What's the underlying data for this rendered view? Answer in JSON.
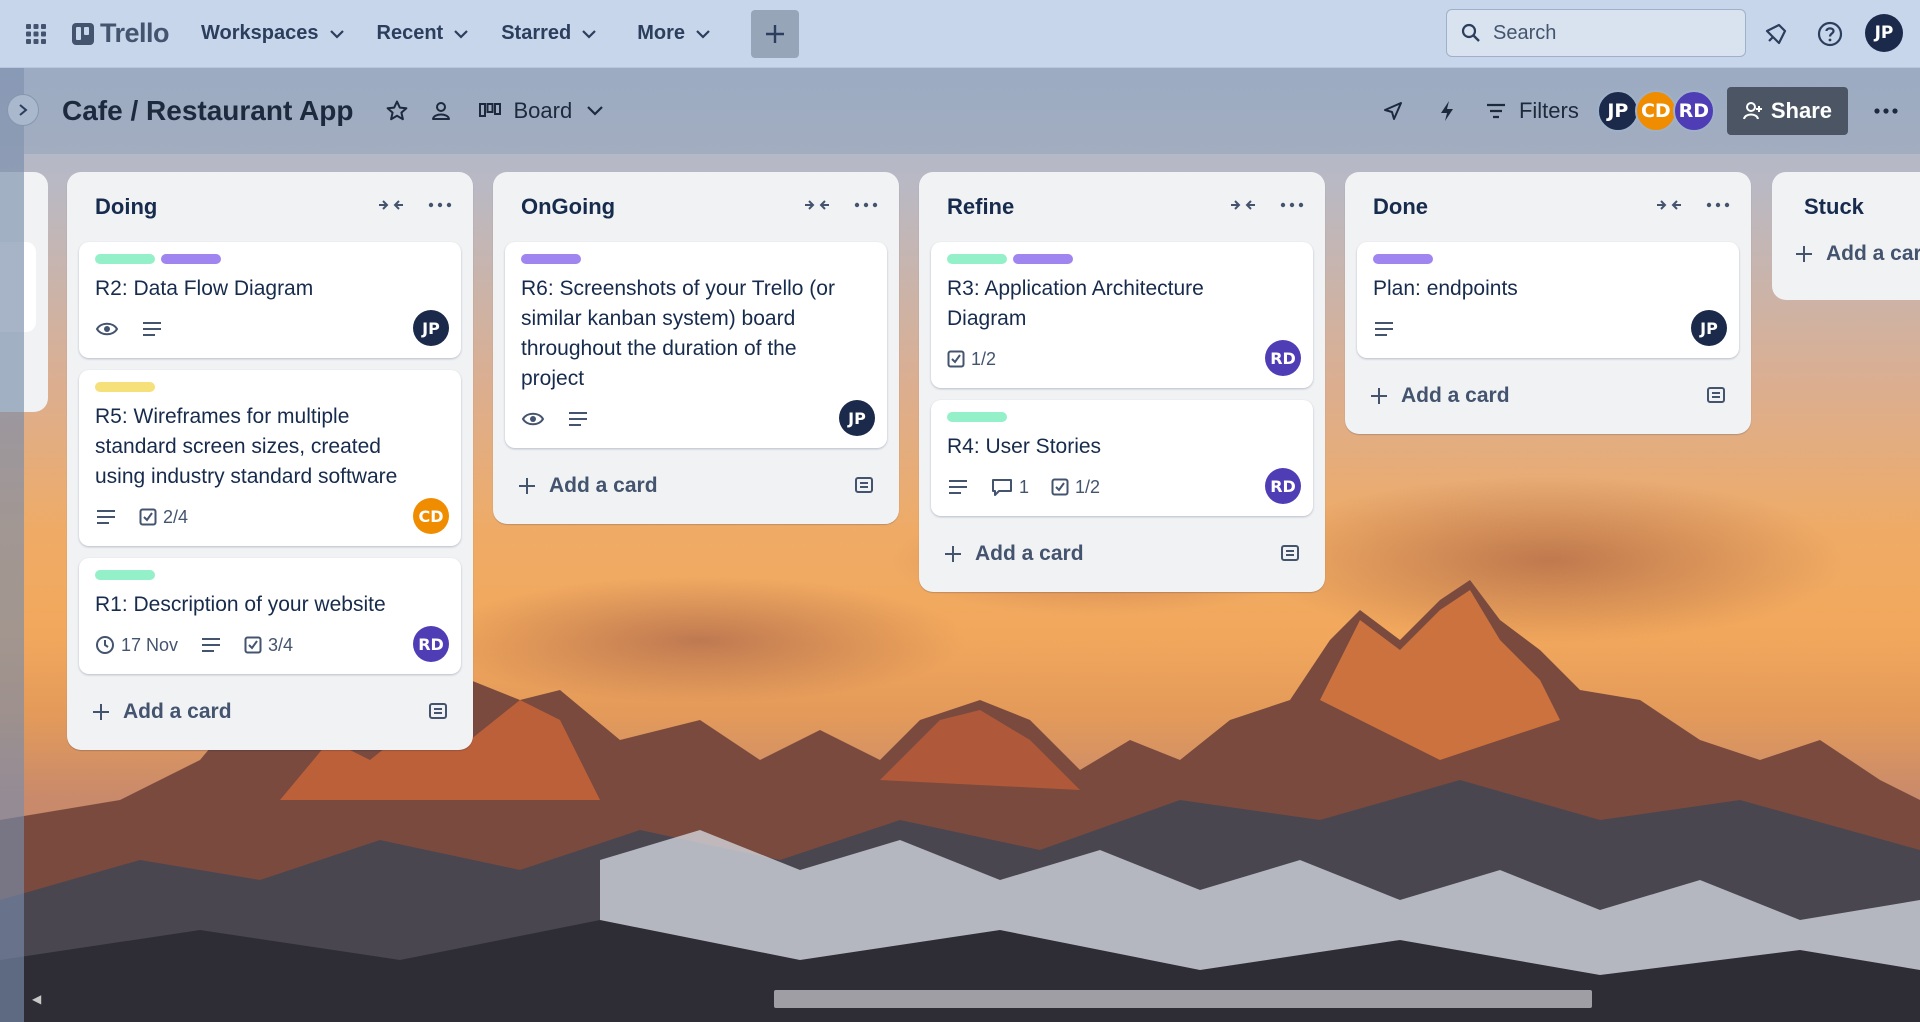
{
  "topnav": {
    "logo_text": "Trello",
    "menus": [
      "Workspaces",
      "Recent",
      "Starred",
      "More"
    ],
    "search_placeholder": "Search",
    "user_initials": "JP"
  },
  "board": {
    "title": "Cafe / Restaurant App",
    "view_label": "Board",
    "filters_label": "Filters",
    "share_label": "Share",
    "members": [
      {
        "initials": "JP",
        "color": "#1b2a4a"
      },
      {
        "initials": "CD",
        "color": "#f08c00"
      },
      {
        "initials": "RD",
        "color": "#4f3db5"
      }
    ]
  },
  "colors": {
    "label_green": "#94f0c8",
    "label_purple": "#a084f0",
    "label_yellow": "#f5e07a",
    "avatar_jp": "#1b2a4a",
    "avatar_cd": "#f08c00",
    "avatar_rd": "#4f3db5"
  },
  "lists": [
    {
      "title": "Doing",
      "add_card": "Add a card",
      "cards": [
        {
          "title": "R2: Data Flow Diagram",
          "labels": [
            "green",
            "purple"
          ],
          "watch": true,
          "description": true,
          "member": "JP"
        },
        {
          "title": "R5: Wireframes for multiple standard screen sizes, created using industry standard software",
          "labels": [
            "yellow"
          ],
          "description": true,
          "checklist": "2/4",
          "member": "CD"
        },
        {
          "title": "R1: Description of your website",
          "labels": [
            "green"
          ],
          "due": "17 Nov",
          "description": true,
          "checklist": "3/4",
          "member": "RD"
        }
      ]
    },
    {
      "title": "OnGoing",
      "add_card": "Add a card",
      "cards": [
        {
          "title": "R6: Screenshots of your Trello (or similar kanban system) board throughout the duration of the project",
          "labels": [
            "purple"
          ],
          "watch": true,
          "description": true,
          "member": "JP"
        }
      ]
    },
    {
      "title": "Refine",
      "add_card": "Add a card",
      "cards": [
        {
          "title": "R3: Application Architecture Diagram",
          "labels": [
            "green",
            "purple"
          ],
          "checklist": "1/2",
          "member": "RD"
        },
        {
          "title": "R4: User Stories",
          "labels": [
            "green"
          ],
          "description": true,
          "comments": "1",
          "checklist": "1/2",
          "member": "RD"
        }
      ]
    },
    {
      "title": "Done",
      "add_card": "Add a card",
      "cards": [
        {
          "title": "Plan: endpoints",
          "labels": [
            "purple"
          ],
          "description": true,
          "member": "JP"
        }
      ]
    },
    {
      "title": "Stuck",
      "add_card": "Add a card",
      "cards": []
    }
  ]
}
